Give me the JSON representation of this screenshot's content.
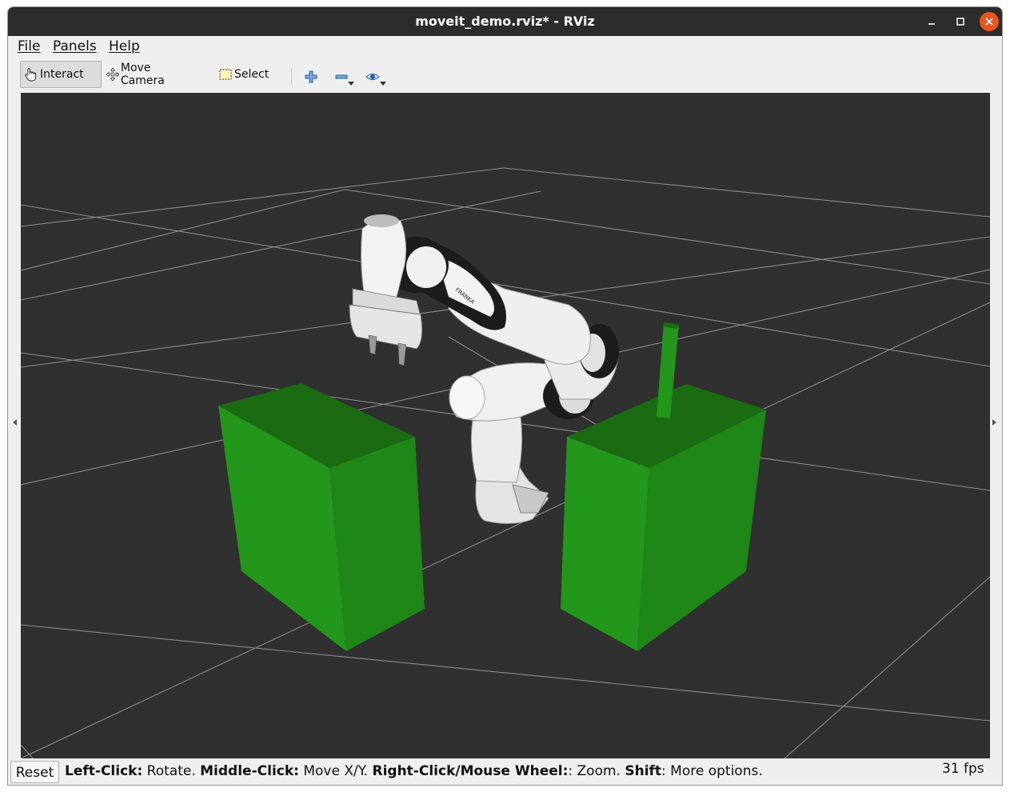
{
  "window": {
    "title": "moveit_demo.rviz* - RViz"
  },
  "menubar": {
    "items": [
      "File",
      "Panels",
      "Help"
    ]
  },
  "toolbar": {
    "interact_label": "Interact",
    "move_camera_label": "Move Camera",
    "select_label": "Select"
  },
  "scene": {
    "robot_brand": "FRANKA",
    "colors": {
      "background": "#303030",
      "grid": "#8a8a8a",
      "box_top": "#1a6b12",
      "box_front": "#23961c",
      "box_side": "#1f8618",
      "robot": "#e8e8e8",
      "joint": "#1a1a1a"
    }
  },
  "statusbar": {
    "reset_label": "Reset",
    "hint": [
      {
        "key": "Left-Click:",
        "text": " Rotate. "
      },
      {
        "key": "Middle-Click:",
        "text": " Move X/Y. "
      },
      {
        "key": "Right-Click/Mouse Wheel:",
        "text": ": Zoom. "
      },
      {
        "key": "Shift",
        "text": ": More options."
      }
    ],
    "fps": "31 fps"
  }
}
